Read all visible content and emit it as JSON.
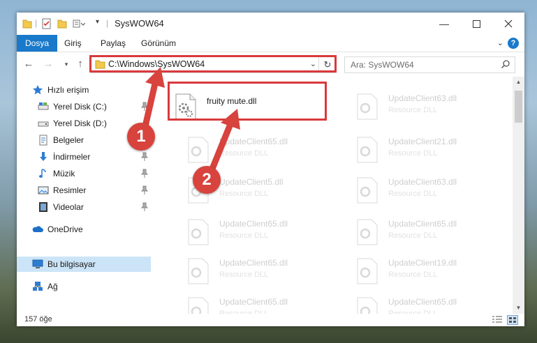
{
  "window": {
    "title": "SysWOW64"
  },
  "ribbon": {
    "tabs": [
      "Dosya",
      "Giriş",
      "Paylaş",
      "Görünüm"
    ],
    "help": "?"
  },
  "address": {
    "path": "C:\\Windows\\SysWOW64"
  },
  "search": {
    "placeholder": "Ara: SysWOW64"
  },
  "sidebar": {
    "items": [
      {
        "label": "Hızlı erişim",
        "icon": "star-icon"
      },
      {
        "label": "Yerel Disk (C:)",
        "icon": "drive-icon"
      },
      {
        "label": "Yerel Disk (D:)",
        "icon": "drive-icon"
      },
      {
        "label": "Belgeler",
        "icon": "documents-icon"
      },
      {
        "label": "İndirmeler",
        "icon": "download-icon"
      },
      {
        "label": "Müzik",
        "icon": "music-icon"
      },
      {
        "label": "Resimler",
        "icon": "pictures-icon"
      },
      {
        "label": "Videolar",
        "icon": "video-icon"
      },
      {
        "label": "OneDrive",
        "icon": "cloud-icon"
      },
      {
        "label": "Bu bilgisayar",
        "icon": "computer-icon"
      },
      {
        "label": "Ağ",
        "icon": "network-icon"
      }
    ]
  },
  "files": {
    "highlighted": {
      "name": "fruity mute.dll"
    },
    "items": [
      {
        "name": "UpdateClient63.dll",
        "type": "Resource DLL"
      },
      {
        "name": "UpdateClient65.dll",
        "type": "Resource DLL"
      },
      {
        "name": "UpdateClient21.dll",
        "type": "Resource DLL"
      },
      {
        "name": "UpdateClient5.dll",
        "type": "Resource DLL"
      },
      {
        "name": "UpdateClient63.dll",
        "type": "Resource DLL"
      },
      {
        "name": "UpdateClient65.dll",
        "type": "Resource DLL"
      },
      {
        "name": "UpdateClient65.dll",
        "type": "Resource DLL"
      },
      {
        "name": "UpdateClient65.dll",
        "type": "Resource DLL"
      },
      {
        "name": "UpdateClient19.dll",
        "type": "Resource DLL"
      },
      {
        "name": "UpdateClient65.dll",
        "type": "Resource DLL"
      },
      {
        "name": "UpdateClient65.dll",
        "type": "Resource DLL"
      }
    ]
  },
  "status": {
    "count": "157 öğe"
  },
  "annotations": {
    "step1": "1",
    "step2": "2",
    "color": "#d8433d"
  }
}
